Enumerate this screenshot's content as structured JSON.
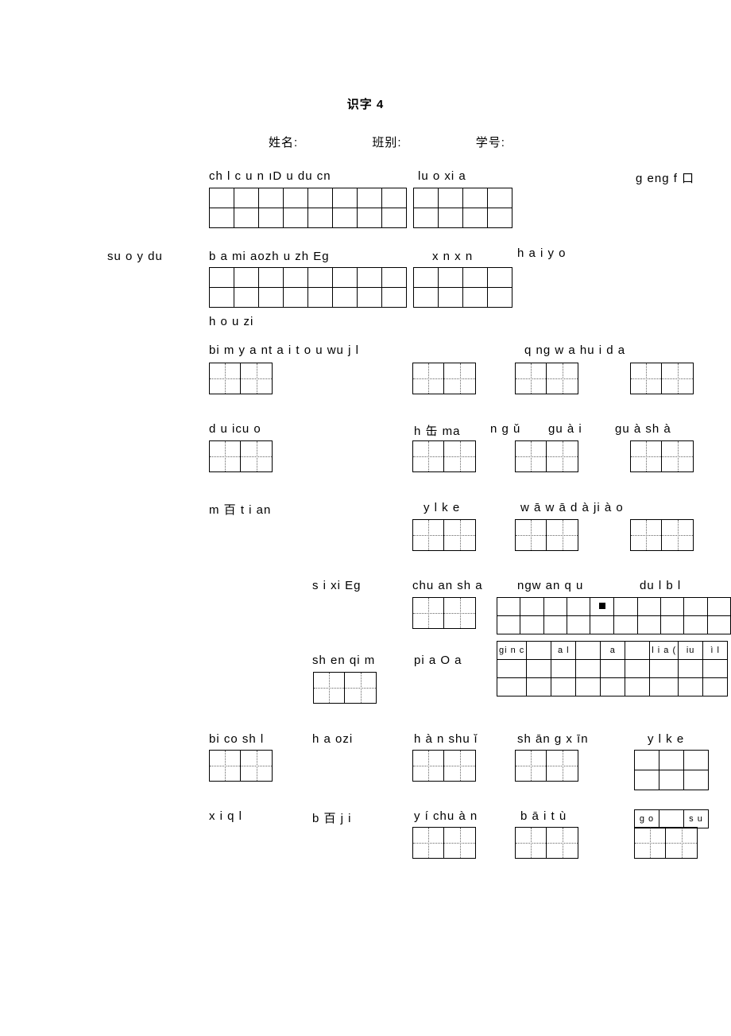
{
  "title": "识字 4",
  "form": {
    "name_label": "姓名:",
    "class_label": "班别:",
    "id_label": "学号:"
  },
  "r1_a": "ch l c u n   ıD u du cn",
  "r1_b": "lu o xi a",
  "r1_c": "g eng f 口",
  "r2_left": "su o y du",
  "r2_a": "b a mi aozh u zh Eg",
  "r2_b": "x n x n",
  "r2_c": "h a i y o",
  "r2_sub": "h o u zi",
  "r3_a": "bi m y a nt a i t o u wu j l",
  "r3_b": "q ng w a hu i d a",
  "r4_a": "d u icu o",
  "r4_b": "h 缶 ma",
  "r4_c": "n  g ǔ",
  "r4_d": "gu à i",
  "r4_e": "gu à sh à",
  "r5_a": "m 百 t i an",
  "r5_b": "y l k e",
  "r5_c": "w ā   w ā   d à ji   à o",
  "r6_a": "s i xi Eg",
  "r6_b": "chu an sh a",
  "r6_c": "ngw an q u",
  "r6_d": "du l b l",
  "r7_a": "sh en qi m",
  "r7_b": "pi a O a",
  "r7_cells": {
    "c1": "gi n c",
    "c2": "a l",
    "c3": "a",
    "c4": "l i a (",
    "c5": "iu",
    "c6": "ì l"
  },
  "r8_a": "bi co sh l",
  "r8_b": "h a ozi",
  "r8_c": "h à n shu ǐ",
  "r8_d": "sh ān g x īn",
  "r8_e": "y l   k e",
  "r9_a": "x i q l",
  "r9_b": "b 百 j i",
  "r9_c": "y í chu  à n",
  "r9_d": "b ā i t ù",
  "r9_e1": "g o",
  "r9_e2": "s u"
}
